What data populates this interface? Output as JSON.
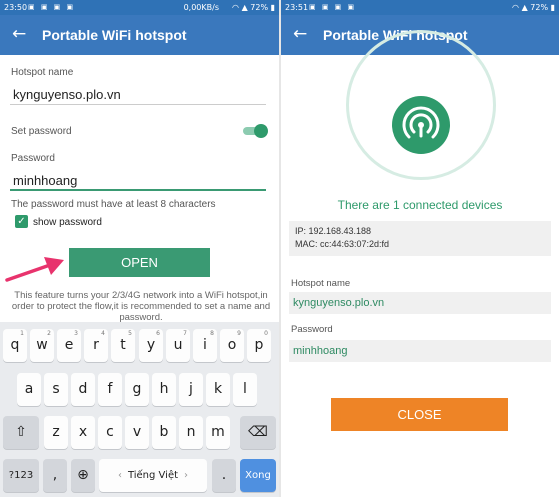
{
  "left": {
    "status": {
      "time": "23:50",
      "netspeed": "0,00KB/s",
      "battery": "72%"
    },
    "appbar": {
      "back": "←",
      "title": "Portable WiFi hotspot"
    },
    "hotspot_name_label": "Hotspot name",
    "hotspot_name_value": "kynguyenso.plo.vn",
    "set_password_label": "Set password",
    "set_password_on": true,
    "password_label": "Password",
    "password_value": "minhhoang",
    "password_hint": "The password must have at least 8 characters",
    "show_password_label": "show password",
    "show_password_checked": true,
    "open_button": "OPEN",
    "feature_text": "This feature turns your 2/3/4G network into a WiFi hotspot,in order to protect the flow,it is recommended to set a name and password."
  },
  "keyboard": {
    "row1": [
      {
        "k": "q",
        "n": "1"
      },
      {
        "k": "w",
        "n": "2"
      },
      {
        "k": "e",
        "n": "3"
      },
      {
        "k": "r",
        "n": "4"
      },
      {
        "k": "t",
        "n": "5"
      },
      {
        "k": "y",
        "n": "6"
      },
      {
        "k": "u",
        "n": "7"
      },
      {
        "k": "i",
        "n": "8"
      },
      {
        "k": "o",
        "n": "9"
      },
      {
        "k": "p",
        "n": "0"
      }
    ],
    "row2": [
      "a",
      "s",
      "d",
      "f",
      "g",
      "h",
      "j",
      "k",
      "l"
    ],
    "row3": [
      "z",
      "x",
      "c",
      "v",
      "b",
      "n",
      "m"
    ],
    "shift": "⇧",
    "backspace": "⌫",
    "symbols": "?123",
    "comma": ",",
    "globe": "⊕",
    "space_label": "Tiếng Việt",
    "space_left": "‹",
    "space_right": "›",
    "period": ".",
    "done": "Xong"
  },
  "right": {
    "status": {
      "time": "23:51",
      "battery": "72%"
    },
    "appbar": {
      "back": "←",
      "title": "Portable WiFi hotspot"
    },
    "connected_text": "There are 1 connected devices",
    "device_ip": "IP: 192.168.43.188",
    "device_mac": "MAC: cc:44:63:07:2d:fd",
    "hotspot_name_label": "Hotspot name",
    "hotspot_name_value": "kynguyenso.plo.vn",
    "password_label": "Password",
    "password_value": "minhhoang",
    "close_button": "CLOSE"
  },
  "colors": {
    "appbar": "#3a78bd",
    "accent_green": "#2e9a6b",
    "close_orange": "#ee8426",
    "arrow_pink": "#e8336d"
  }
}
